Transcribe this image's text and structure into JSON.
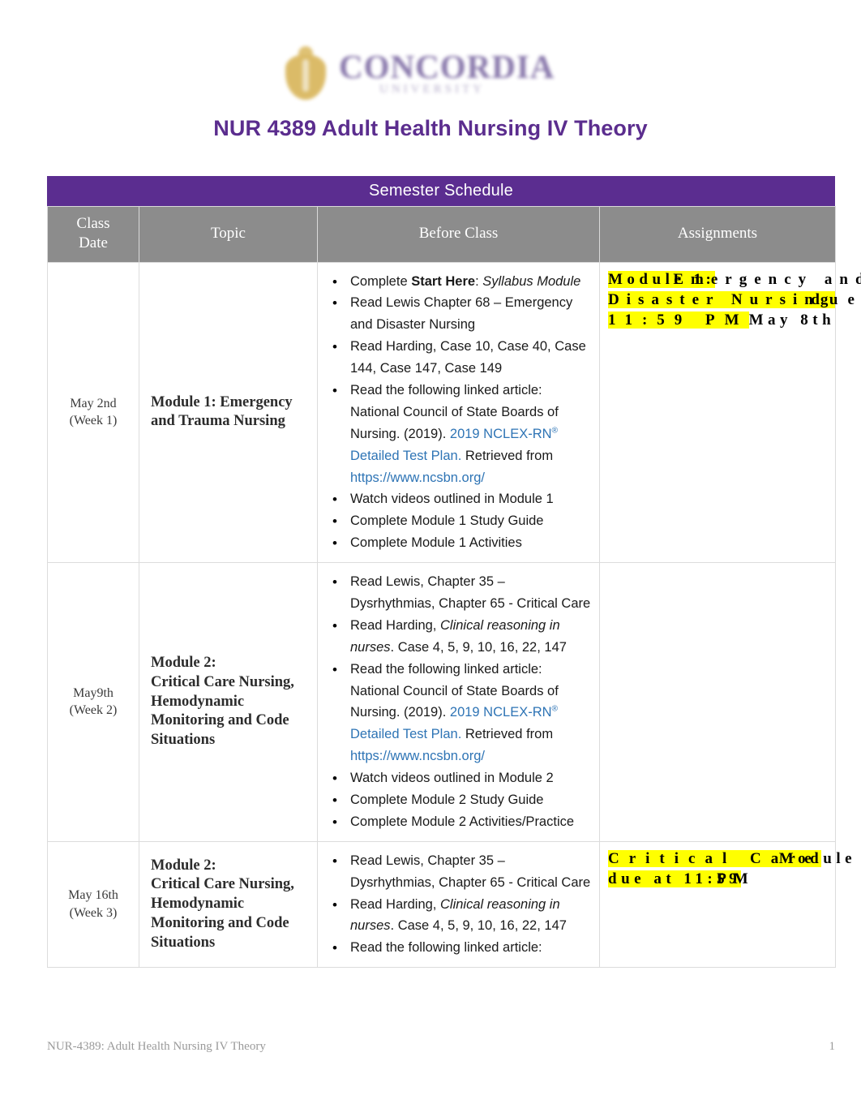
{
  "header": {
    "logo_name": "concordia-university-logo",
    "wordmark": "CONCORDIA",
    "wordmark_sub": "UNIVERSITY",
    "doc_title": "NUR 4389 Adult Health Nursing IV Theory",
    "title_color": "#5B2D8E"
  },
  "table": {
    "banner": "Semester Schedule",
    "banner_color": "#5B2D90",
    "header_bg": "#8C8C8C",
    "columns": [
      {
        "line1": "Class",
        "line2": "Date"
      },
      {
        "line1": "Topic",
        "line2": ""
      },
      {
        "line1": "Before Class",
        "line2": ""
      },
      {
        "line1": "Assignments",
        "line2": ""
      }
    ],
    "rows": [
      {
        "date_line1": "May 2nd",
        "date_line2": "(Week 1)",
        "topic": "Module 1: Emergency and Trauma Nursing",
        "before_class": [
          {
            "segments": [
              {
                "t": "Complete ",
                "s": "plain"
              },
              {
                "t": "Start Here",
                "s": "bold"
              },
              {
                "t": ": ",
                "s": "plain"
              },
              {
                "t": "Syllabus Module",
                "s": "italic"
              }
            ]
          },
          {
            "segments": [
              {
                "t": "Read Lewis Chapter 68 – Emergency and Disaster Nursing",
                "s": "plain"
              }
            ]
          },
          {
            "segments": [
              {
                "t": "Read Harding, Case 10, Case 40, Case 144, Case 147, Case 149",
                "s": "plain"
              }
            ]
          },
          {
            "segments": [
              {
                "t": "Read the following linked article: National Council of State Boards of Nursing. (2019). ",
                "s": "plain"
              },
              {
                "t": "2019 NCLEX-RN",
                "s": "link"
              },
              {
                "t": "®",
                "s": "link-sup"
              },
              {
                "t": " Detailed Test Plan.",
                "s": "link"
              },
              {
                "t": "  Retrieved from ",
                "s": "plain"
              },
              {
                "t": "https://www.ncsbn.org/",
                "s": "link"
              }
            ]
          },
          {
            "segments": [
              {
                "t": "Watch videos outlined in Module 1",
                "s": "plain"
              }
            ]
          },
          {
            "segments": [
              {
                "t": "Complete Module 1 Study Guide",
                "s": "plain"
              }
            ]
          },
          {
            "segments": [
              {
                "t": "Complete Module 1 Activities",
                "s": "plain"
              }
            ]
          }
        ],
        "assignment_lines": [
          {
            "hl": "Module 1:",
            "tail": "Emergency and"
          },
          {
            "hl": "Disaster Nursing",
            "tail": "due at"
          },
          {
            "hl": "11:59 PM",
            "tail": "May 8th"
          }
        ],
        "assignment_text": "Module 1: Emergency and Disaster Nursing due at 11:59 PM May 8th"
      },
      {
        "date_line1": "May9th",
        "date_line2": "(Week 2)",
        "topic": "Module 2:\nCritical Care Nursing, Hemodynamic Monitoring and Code Situations",
        "before_class": [
          {
            "segments": [
              {
                "t": "Read Lewis, Chapter 35 – Dysrhythmias, Chapter 65 - Critical Care",
                "s": "plain"
              }
            ]
          },
          {
            "segments": [
              {
                "t": "Read Harding, ",
                "s": "plain"
              },
              {
                "t": "Clinical reasoning in nurses",
                "s": "italic"
              },
              {
                "t": ". Case 4, 5, 9, 10, 16, 22, 147",
                "s": "plain"
              }
            ]
          },
          {
            "segments": [
              {
                "t": "Read the following linked article: National Council of State Boards of Nursing. (2019). ",
                "s": "plain"
              },
              {
                "t": "2019 NCLEX-RN",
                "s": "link"
              },
              {
                "t": "®",
                "s": "link-sup"
              },
              {
                "t": " Detailed Test Plan.",
                "s": "link"
              },
              {
                "t": "  Retrieved from ",
                "s": "plain"
              },
              {
                "t": "https://www.ncsbn.org/",
                "s": "link"
              }
            ]
          },
          {
            "segments": [
              {
                "t": "Watch videos outlined in Module 2",
                "s": "plain"
              }
            ]
          },
          {
            "segments": [
              {
                "t": "Complete Module 2 Study Guide",
                "s": "plain"
              }
            ]
          },
          {
            "segments": [
              {
                "t": "Complete Module 2 Activities/Practice",
                "s": "plain"
              }
            ]
          }
        ],
        "assignment_lines": [],
        "assignment_text": ""
      },
      {
        "date_line1": "May 16th",
        "date_line2": "(Week 3)",
        "topic": "Module 2:\nCritical Care Nursing, Hemodynamic Monitoring and Code Situations",
        "before_class": [
          {
            "segments": [
              {
                "t": "Read Lewis, Chapter 35 – Dysrhythmias, Chapter 65 - Critical Care",
                "s": "plain"
              }
            ]
          },
          {
            "segments": [
              {
                "t": "Read Harding, ",
                "s": "plain"
              },
              {
                "t": "Clinical reasoning in nurses",
                "s": "italic"
              },
              {
                "t": ". Case 4, 5, 9, 10, 16, 22, 147",
                "s": "plain"
              }
            ]
          },
          {
            "segments": [
              {
                "t": "Read the following linked article:",
                "s": "plain"
              }
            ]
          }
        ],
        "assignment_lines": [
          {
            "hl": "Critical Care",
            "tail": "Module"
          },
          {
            "hl": "due at 11:59",
            "tail": "PM"
          }
        ],
        "assignment_text": "Critical Care Module due at 11:59 PM"
      }
    ]
  },
  "footer": {
    "left": "NUR-4389: Adult Health Nursing IV Theory",
    "page_number": "1"
  }
}
